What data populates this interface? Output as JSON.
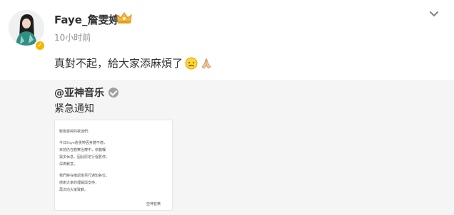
{
  "post": {
    "username": "Faye_詹雯婷",
    "time": "10小时前",
    "content": "真對不起，給大家添麻煩了"
  },
  "repost": {
    "username": "@亚神音乐",
    "text": "紧急通知",
    "image": {
      "lines": [
        "致詹雯婷的歌迷們：",
        "今日Faye詹雯婷因身體不適，",
        "目前仍在觀察治療中，依醫囑",
        "需多休息。因此原定行程暫停，",
        "深表歉意。",
        "我們將在確認後另行通知各位，",
        "感謝大家的理解與支持，",
        "再次向大家致歉。",
        "亞神音樂"
      ]
    }
  },
  "colors": {
    "verified_gold": "#f7b500",
    "repost_bg": "#f5f5f5",
    "time_gray": "#939393"
  },
  "icons": {
    "avatar": "avatar-photo",
    "crown": "crown-icon",
    "chevron": "chevron-down-icon",
    "emoji_sad": "sad-face-emoji",
    "emoji_pray": "praying-hands-emoji",
    "verified": "verified-badge-icon"
  }
}
